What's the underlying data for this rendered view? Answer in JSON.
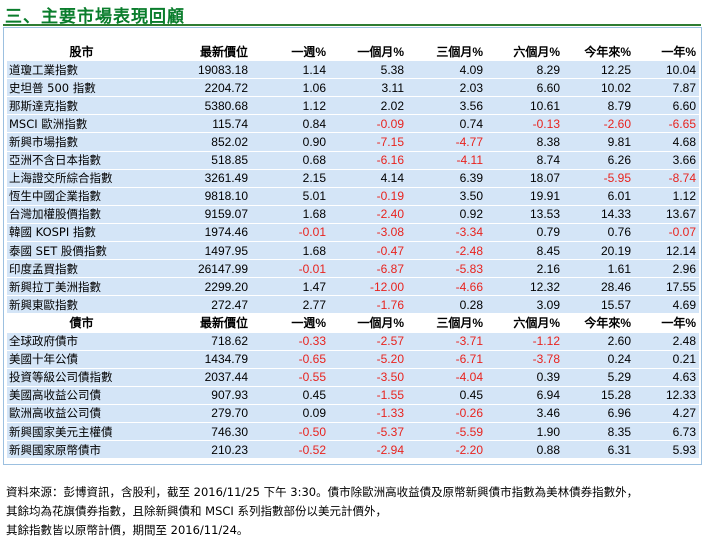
{
  "title": "三、主要市場表現回顧",
  "stock_header": {
    "name": "股市",
    "cols": [
      "最新價位",
      "一週%",
      "一個月%",
      "三個月%",
      "六個月%",
      "今年來%",
      "一年%"
    ]
  },
  "stock_rows": [
    {
      "name": "道瓊工業指數",
      "values": [
        "19083.18",
        "1.14",
        "5.38",
        "4.09",
        "8.29",
        "12.25",
        "10.04"
      ]
    },
    {
      "name": "史坦普 500 指數",
      "values": [
        "2204.72",
        "1.06",
        "3.11",
        "2.03",
        "6.60",
        "10.02",
        "7.87"
      ]
    },
    {
      "name": "那斯達克指數",
      "values": [
        "5380.68",
        "1.12",
        "2.02",
        "3.56",
        "10.61",
        "8.79",
        "6.60"
      ]
    },
    {
      "name": "MSCI 歐洲指數",
      "values": [
        "115.74",
        "0.84",
        "-0.09",
        "0.74",
        "-0.13",
        "-2.60",
        "-6.65"
      ]
    },
    {
      "name": "新興市場指數",
      "values": [
        "852.02",
        "0.90",
        "-7.15",
        "-4.77",
        "8.38",
        "9.81",
        "4.68"
      ]
    },
    {
      "name": "亞洲不含日本指數",
      "values": [
        "518.85",
        "0.68",
        "-6.16",
        "-4.11",
        "8.74",
        "6.26",
        "3.66"
      ]
    },
    {
      "name": "上海證交所綜合指數",
      "values": [
        "3261.49",
        "2.15",
        "4.14",
        "6.39",
        "18.07",
        "-5.95",
        "-8.74"
      ]
    },
    {
      "name": "恆生中國企業指數",
      "values": [
        "9818.10",
        "5.01",
        "-0.19",
        "3.50",
        "19.91",
        "6.01",
        "1.12"
      ]
    },
    {
      "name": "台灣加權股價指數",
      "values": [
        "9159.07",
        "1.68",
        "-2.40",
        "0.92",
        "13.53",
        "14.33",
        "13.67"
      ]
    },
    {
      "name": "韓國 KOSPI 指數",
      "values": [
        "1974.46",
        "-0.01",
        "-3.08",
        "-3.34",
        "0.79",
        "0.76",
        "-0.07"
      ]
    },
    {
      "name": "泰國 SET 股價指數",
      "values": [
        "1497.95",
        "1.68",
        "-0.47",
        "-2.48",
        "8.45",
        "20.19",
        "12.14"
      ]
    },
    {
      "name": "印度孟買指數",
      "values": [
        "26147.99",
        "-0.01",
        "-6.87",
        "-5.83",
        "2.16",
        "1.61",
        "2.96"
      ]
    },
    {
      "name": "新興拉丁美洲指數",
      "values": [
        "2299.20",
        "1.47",
        "-12.00",
        "-4.66",
        "12.32",
        "28.46",
        "17.55"
      ]
    },
    {
      "name": "新興東歐指數",
      "values": [
        "272.47",
        "2.77",
        "-1.76",
        "0.28",
        "3.09",
        "15.57",
        "4.69"
      ]
    }
  ],
  "bond_header": {
    "name": "債市",
    "cols": [
      "最新價位",
      "一週%",
      "一個月%",
      "三個月%",
      "六個月%",
      "今年來%",
      "一年%"
    ]
  },
  "bond_rows": [
    {
      "name": "全球政府債市",
      "values": [
        "718.62",
        "-0.33",
        "-2.57",
        "-3.71",
        "-1.12",
        "2.60",
        "2.48"
      ]
    },
    {
      "name": "美國十年公債",
      "values": [
        "1434.79",
        "-0.65",
        "-5.20",
        "-6.71",
        "-3.78",
        "0.24",
        "0.21"
      ]
    },
    {
      "name": "投資等級公司債指數",
      "values": [
        "2037.44",
        "-0.55",
        "-3.50",
        "-4.04",
        "0.39",
        "5.29",
        "4.63"
      ]
    },
    {
      "name": "美國高收益公司債",
      "values": [
        "907.93",
        "0.45",
        "-1.55",
        "0.45",
        "6.94",
        "15.28",
        "12.33"
      ]
    },
    {
      "name": "歐洲高收益公司債",
      "values": [
        "279.70",
        "0.09",
        "-1.33",
        "-0.26",
        "3.46",
        "6.96",
        "4.27"
      ]
    },
    {
      "name": "新興國家美元主權債",
      "values": [
        "746.30",
        "-0.50",
        "-5.37",
        "-5.59",
        "1.90",
        "8.35",
        "6.73"
      ]
    },
    {
      "name": "新興國家原幣債市",
      "values": [
        "210.23",
        "-0.52",
        "-2.94",
        "-2.20",
        "0.88",
        "6.31",
        "5.93"
      ]
    }
  ],
  "footer": [
    "資料來源：彭博資訊，含股利，截至 2016/11/25 下午 3:30。債市除歐洲高收益債及原幣新興債市指數為美林債券指數外，",
    "其餘均為花旗債券指數，且除新興債和 MSCI 系列指數部份以美元計價外，",
    "其餘指數皆以原幣計價，期間至 2016/11/24。"
  ],
  "colors": {
    "title": "#0a7d2c",
    "row_bg": "#d4e5f7",
    "negative": "#e8231e",
    "frame": "#9cc0e0"
  }
}
